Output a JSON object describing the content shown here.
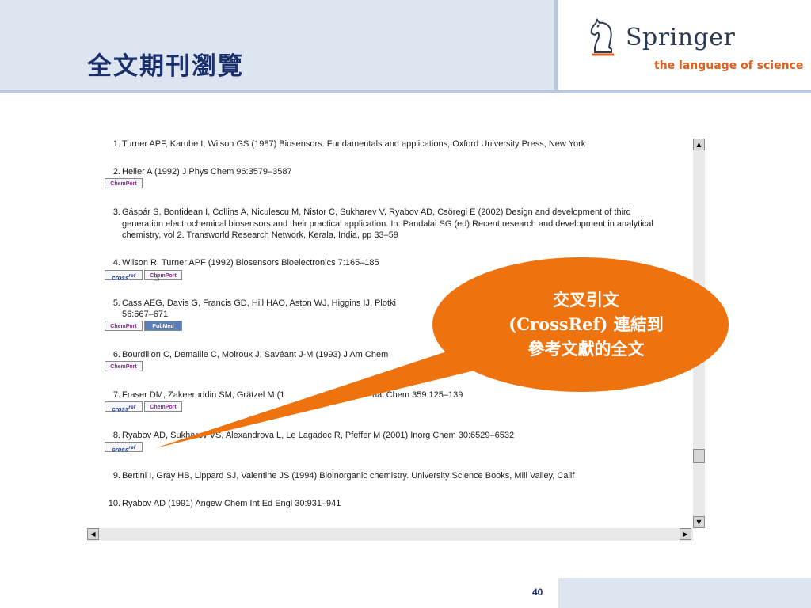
{
  "slide": {
    "title": "全文期刊瀏覽",
    "page_number": "40"
  },
  "logo": {
    "name": "Springer",
    "tagline": "the language of science",
    "icon": "knight-horse-icon"
  },
  "references": [
    {
      "num": "1.",
      "text": "Turner APF, Karube I, Wilson GS (1987) Biosensors. Fundamentals and applications, Oxford University Press, New York",
      "links": []
    },
    {
      "num": "2.",
      "text": "Heller A (1992) J Phys Chem 96:3579–3587",
      "links": [
        "ChemPort"
      ]
    },
    {
      "num": "3.",
      "text": "Gáspár S, Bontidean I, Collins A, Niculescu M, Nistor C, Sukharev V, Ryabov AD, Csöregi E (2002) Design and development of third generation electrochemical biosensors and their practical application. In: Pandalai SG (ed) Recent research and development in analytical chemistry, vol 2. Transworld Research Network, Kerala, India, pp 33–59",
      "links": []
    },
    {
      "num": "4.",
      "text": "Wilson R, Turner APF (1992) Biosensors Bioelectronics 7:165–185",
      "links": [
        "crossref",
        "ChemPort"
      ]
    },
    {
      "num": "5.",
      "text": "Cass AEG, Davis G, Francis GD, Hill HAO, Aston WJ, Higgins IJ, Plotki",
      "text2": "56:667–671",
      "links": [
        "ChemPort",
        "PubMed"
      ]
    },
    {
      "num": "6.",
      "text": "Bourdillon C, Demaille C, Moiroux J, Savéant J-M (1993) J Am Chem",
      "links": [
        "ChemPort"
      ]
    },
    {
      "num": "7.",
      "text": "Fraser DM, Zakeeruddin SM, Grätzel M (1",
      "text_tail": "nal Chem 359:125–139",
      "links": [
        "crossref",
        "ChemPort"
      ]
    },
    {
      "num": "8.",
      "text": "Ryabov AD, Sukharev VS, Alexandrova L, Le Lagadec R, Pfeffer M (2001) Inorg Chem 30:6529–6532",
      "links": [
        "crossref"
      ]
    },
    {
      "num": "9.",
      "text": "Bertini I, Gray HB, Lippard SJ, Valentine JS (1994) Bioinorganic chemistry. University Science Books, Mill Valley, Calif",
      "links": []
    },
    {
      "num": "10.",
      "text": "Ryabov AD (1991) Angew Chem Int Ed Engl 30:931–941",
      "links": []
    }
  ],
  "link_labels": {
    "chemport": "ChemPort",
    "crossref": "cross",
    "crossref_sup": "ref",
    "pubmed": "PubMed"
  },
  "callout": {
    "line1": "交叉引文",
    "line2": "(CrossRef) 連結到",
    "line3": "參考文獻的全文",
    "color": "#ee720d"
  },
  "colors": {
    "header_bg": "#dce5f0",
    "title": "#1b2f6b",
    "tagline": "#e0601b"
  }
}
